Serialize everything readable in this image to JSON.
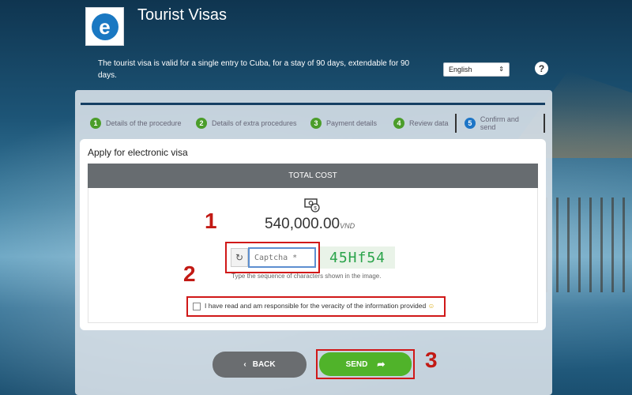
{
  "header": {
    "title": "Tourist Visas",
    "description": "The tourist visa is valid for a single entry to Cuba, for a stay of 90 days, extendable for 90 days.",
    "language_value": "English",
    "help_label": "?"
  },
  "steps": [
    {
      "num": "1",
      "label": "Details of the procedure"
    },
    {
      "num": "2",
      "label": "Details of extra procedures"
    },
    {
      "num": "3",
      "label": "Payment details"
    },
    {
      "num": "4",
      "label": "Review data"
    },
    {
      "num": "5",
      "label": "Confirm and send"
    }
  ],
  "card": {
    "title": "Apply for electronic visa",
    "total_cost_label": "TOTAL COST",
    "amount": "540,000.00",
    "currency": "VND"
  },
  "captcha": {
    "placeholder": "Captcha *",
    "image_text": "45Hf54",
    "help": "Type the sequence of characters shown in the image."
  },
  "agreement": {
    "text": "I have read and am responsible for the veracity of the information provided",
    "emoji": "☺"
  },
  "annotations": [
    "1",
    "2",
    "3"
  ],
  "buttons": {
    "back": "BACK",
    "send": "SEND"
  },
  "colors": {
    "step_done": "#4b9d2a",
    "step_active": "#1d75c6",
    "send": "#50b32a",
    "back": "#6a6d70",
    "highlight": "#d01818"
  },
  "icons": [
    "logo-icon",
    "help-icon",
    "money-icon",
    "refresh-icon",
    "smile-icon",
    "send-arrow-icon",
    "back-chevron-icon"
  ]
}
